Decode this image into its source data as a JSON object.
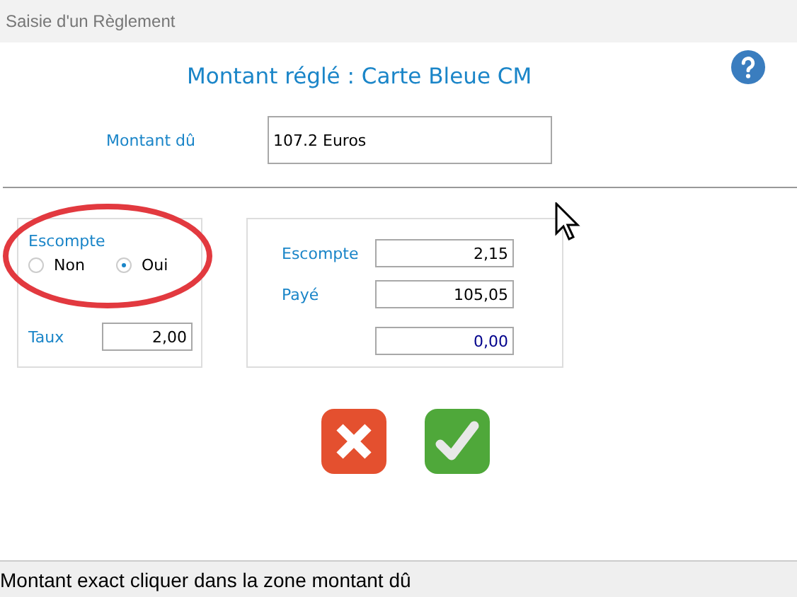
{
  "window": {
    "title": "Saisie d'un Règlement"
  },
  "heading": "Montant réglé : Carte Bleue CM",
  "amount_due": {
    "label": "Montant dû",
    "value": "107.2 Euros"
  },
  "discount": {
    "label": "Escompte",
    "options": [
      {
        "label": "Non",
        "selected": false
      },
      {
        "label": "Oui",
        "selected": true
      }
    ],
    "rate": {
      "label": "Taux",
      "value": "2,00"
    }
  },
  "totals": [
    {
      "label": "Escompte",
      "value": "2,15"
    },
    {
      "label": "Payé",
      "value": "105,05"
    },
    {
      "value": "0,00"
    }
  ],
  "buttons": [
    {
      "kind": "cancel"
    },
    {
      "kind": "ok"
    }
  ],
  "status_bar": "Montant exact cliquer dans la zone montant dû"
}
